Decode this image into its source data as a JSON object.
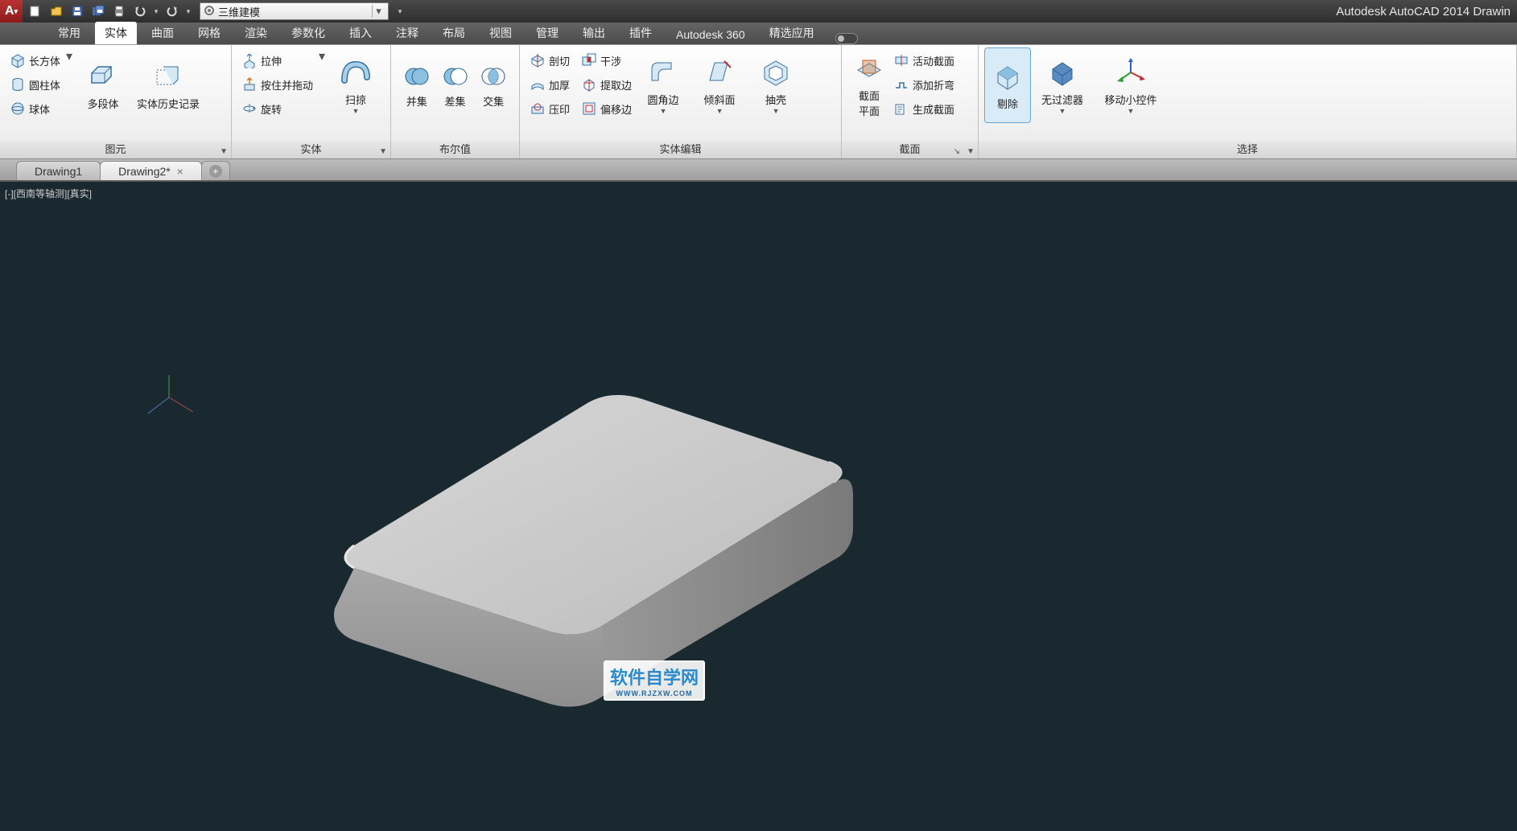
{
  "title_right": "Autodesk AutoCAD 2014    Drawin",
  "workspace": "三维建模",
  "ribbon_tabs": [
    "常用",
    "实体",
    "曲面",
    "网格",
    "渲染",
    "参数化",
    "插入",
    "注释",
    "布局",
    "视图",
    "管理",
    "输出",
    "插件",
    "Autodesk 360",
    "精选应用"
  ],
  "active_ribbon_tab": 1,
  "panels": {
    "p0": {
      "title": "图元",
      "prims": [
        "长方体",
        "圆柱体",
        "球体"
      ],
      "polysolid": "多段体",
      "history": "实体历史记录"
    },
    "p1": {
      "title": "实体",
      "rows": [
        "拉伸",
        "按住并拖动",
        "旋转"
      ],
      "sweep": "扫掠"
    },
    "p2": {
      "title": "布尔值",
      "union": "并集",
      "diff": "差集",
      "inter": "交集"
    },
    "p3": {
      "title": "实体编辑",
      "colA": [
        "剖切",
        "加厚",
        "压印"
      ],
      "colB": [
        "干涉",
        "提取边",
        "偏移边"
      ],
      "fillet": "圆角边",
      "taper": "倾斜面",
      "shell": "抽壳"
    },
    "p4": {
      "title": "截面",
      "plane": "截面\n平面",
      "rows": [
        "活动截面",
        "添加折弯",
        "生成截面"
      ]
    },
    "p5": {
      "title": "选择",
      "cull": "剔除",
      "nofilter": "无过滤器",
      "gizmo": "移动小控件"
    }
  },
  "doc_tabs": [
    {
      "label": "Drawing1",
      "active": false,
      "dirty": false
    },
    {
      "label": "Drawing2*",
      "active": true,
      "dirty": true
    }
  ],
  "view_label": "[-][西南等轴测][真实]",
  "watermark": {
    "main": "软件自学网",
    "sub": "WWW.RJZXW.COM"
  }
}
